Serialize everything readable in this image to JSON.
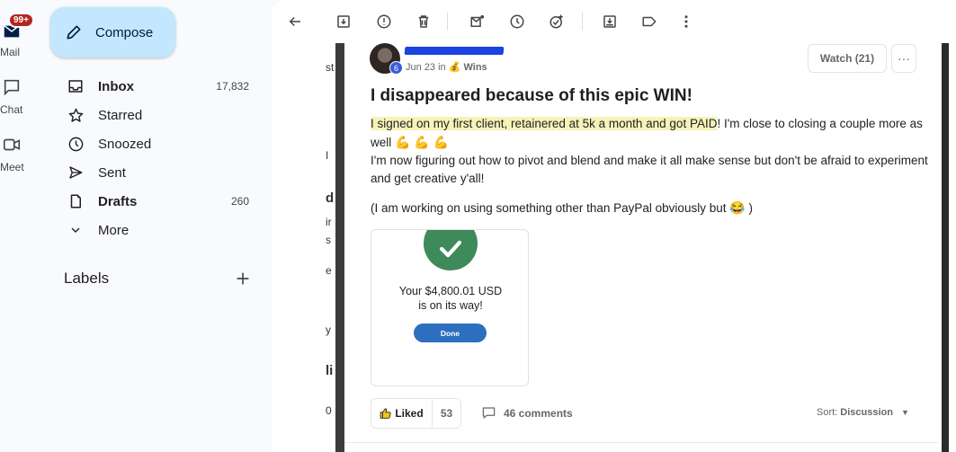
{
  "rail": {
    "mail_label": "Mail",
    "mail_badge": "99+",
    "chat_label": "Chat",
    "meet_label": "Meet"
  },
  "sidebar": {
    "compose_label": "Compose",
    "items": [
      {
        "label": "Inbox",
        "count": "17,832",
        "icon": "inbox-icon"
      },
      {
        "label": "Starred",
        "count": "",
        "icon": "star-icon"
      },
      {
        "label": "Snoozed",
        "count": "",
        "icon": "clock-icon"
      },
      {
        "label": "Sent",
        "count": "",
        "icon": "send-icon"
      },
      {
        "label": "Drafts",
        "count": "260",
        "icon": "draft-icon"
      },
      {
        "label": "More",
        "count": "",
        "icon": "chevron-down-icon"
      }
    ],
    "labels_title": "Labels"
  },
  "toolbar": {
    "icons": [
      "back-arrow-icon",
      "archive-icon",
      "report-spam-icon",
      "delete-icon",
      "mark-unread-icon",
      "snooze-icon",
      "add-task-icon",
      "move-to-icon",
      "label-icon",
      "more-vert-icon"
    ]
  },
  "post": {
    "level": "6",
    "date": "Jun 23 in",
    "category_emoji": "💰",
    "category": "Wins",
    "watch_label": "Watch (21)",
    "more_label": "···",
    "title": "I disappeared because of this epic WIN!",
    "p1_highlight": "I signed on my first client, retainered at 5k a month and got PAID",
    "p1_rest": "! I'm close to closing a couple more as well",
    "p1_emoji": "💪 💪 💪",
    "p2": "I'm now figuring out how to pivot and blend and make it all make sense but don't be afraid to experiment and get creative y'all!",
    "p3": "(I am working on using something other than PayPal obviously but",
    "p3_emoji": "😂",
    "p3_end": ")",
    "receipt_line1": "Your $4,800.01 USD",
    "receipt_line2": "is on its way!",
    "receipt_done": "Done",
    "liked_label": "Liked",
    "like_count": "53",
    "comments_label": "46 comments",
    "sort_prefix": "Sort:",
    "sort_value": "Discussion"
  },
  "colors": {
    "compose_bg": "#c2e7ff",
    "badge": "#b3261e",
    "highlight": "#f6f3b8",
    "check_green": "#3f8a5a",
    "done_blue": "#2c6fbe"
  }
}
